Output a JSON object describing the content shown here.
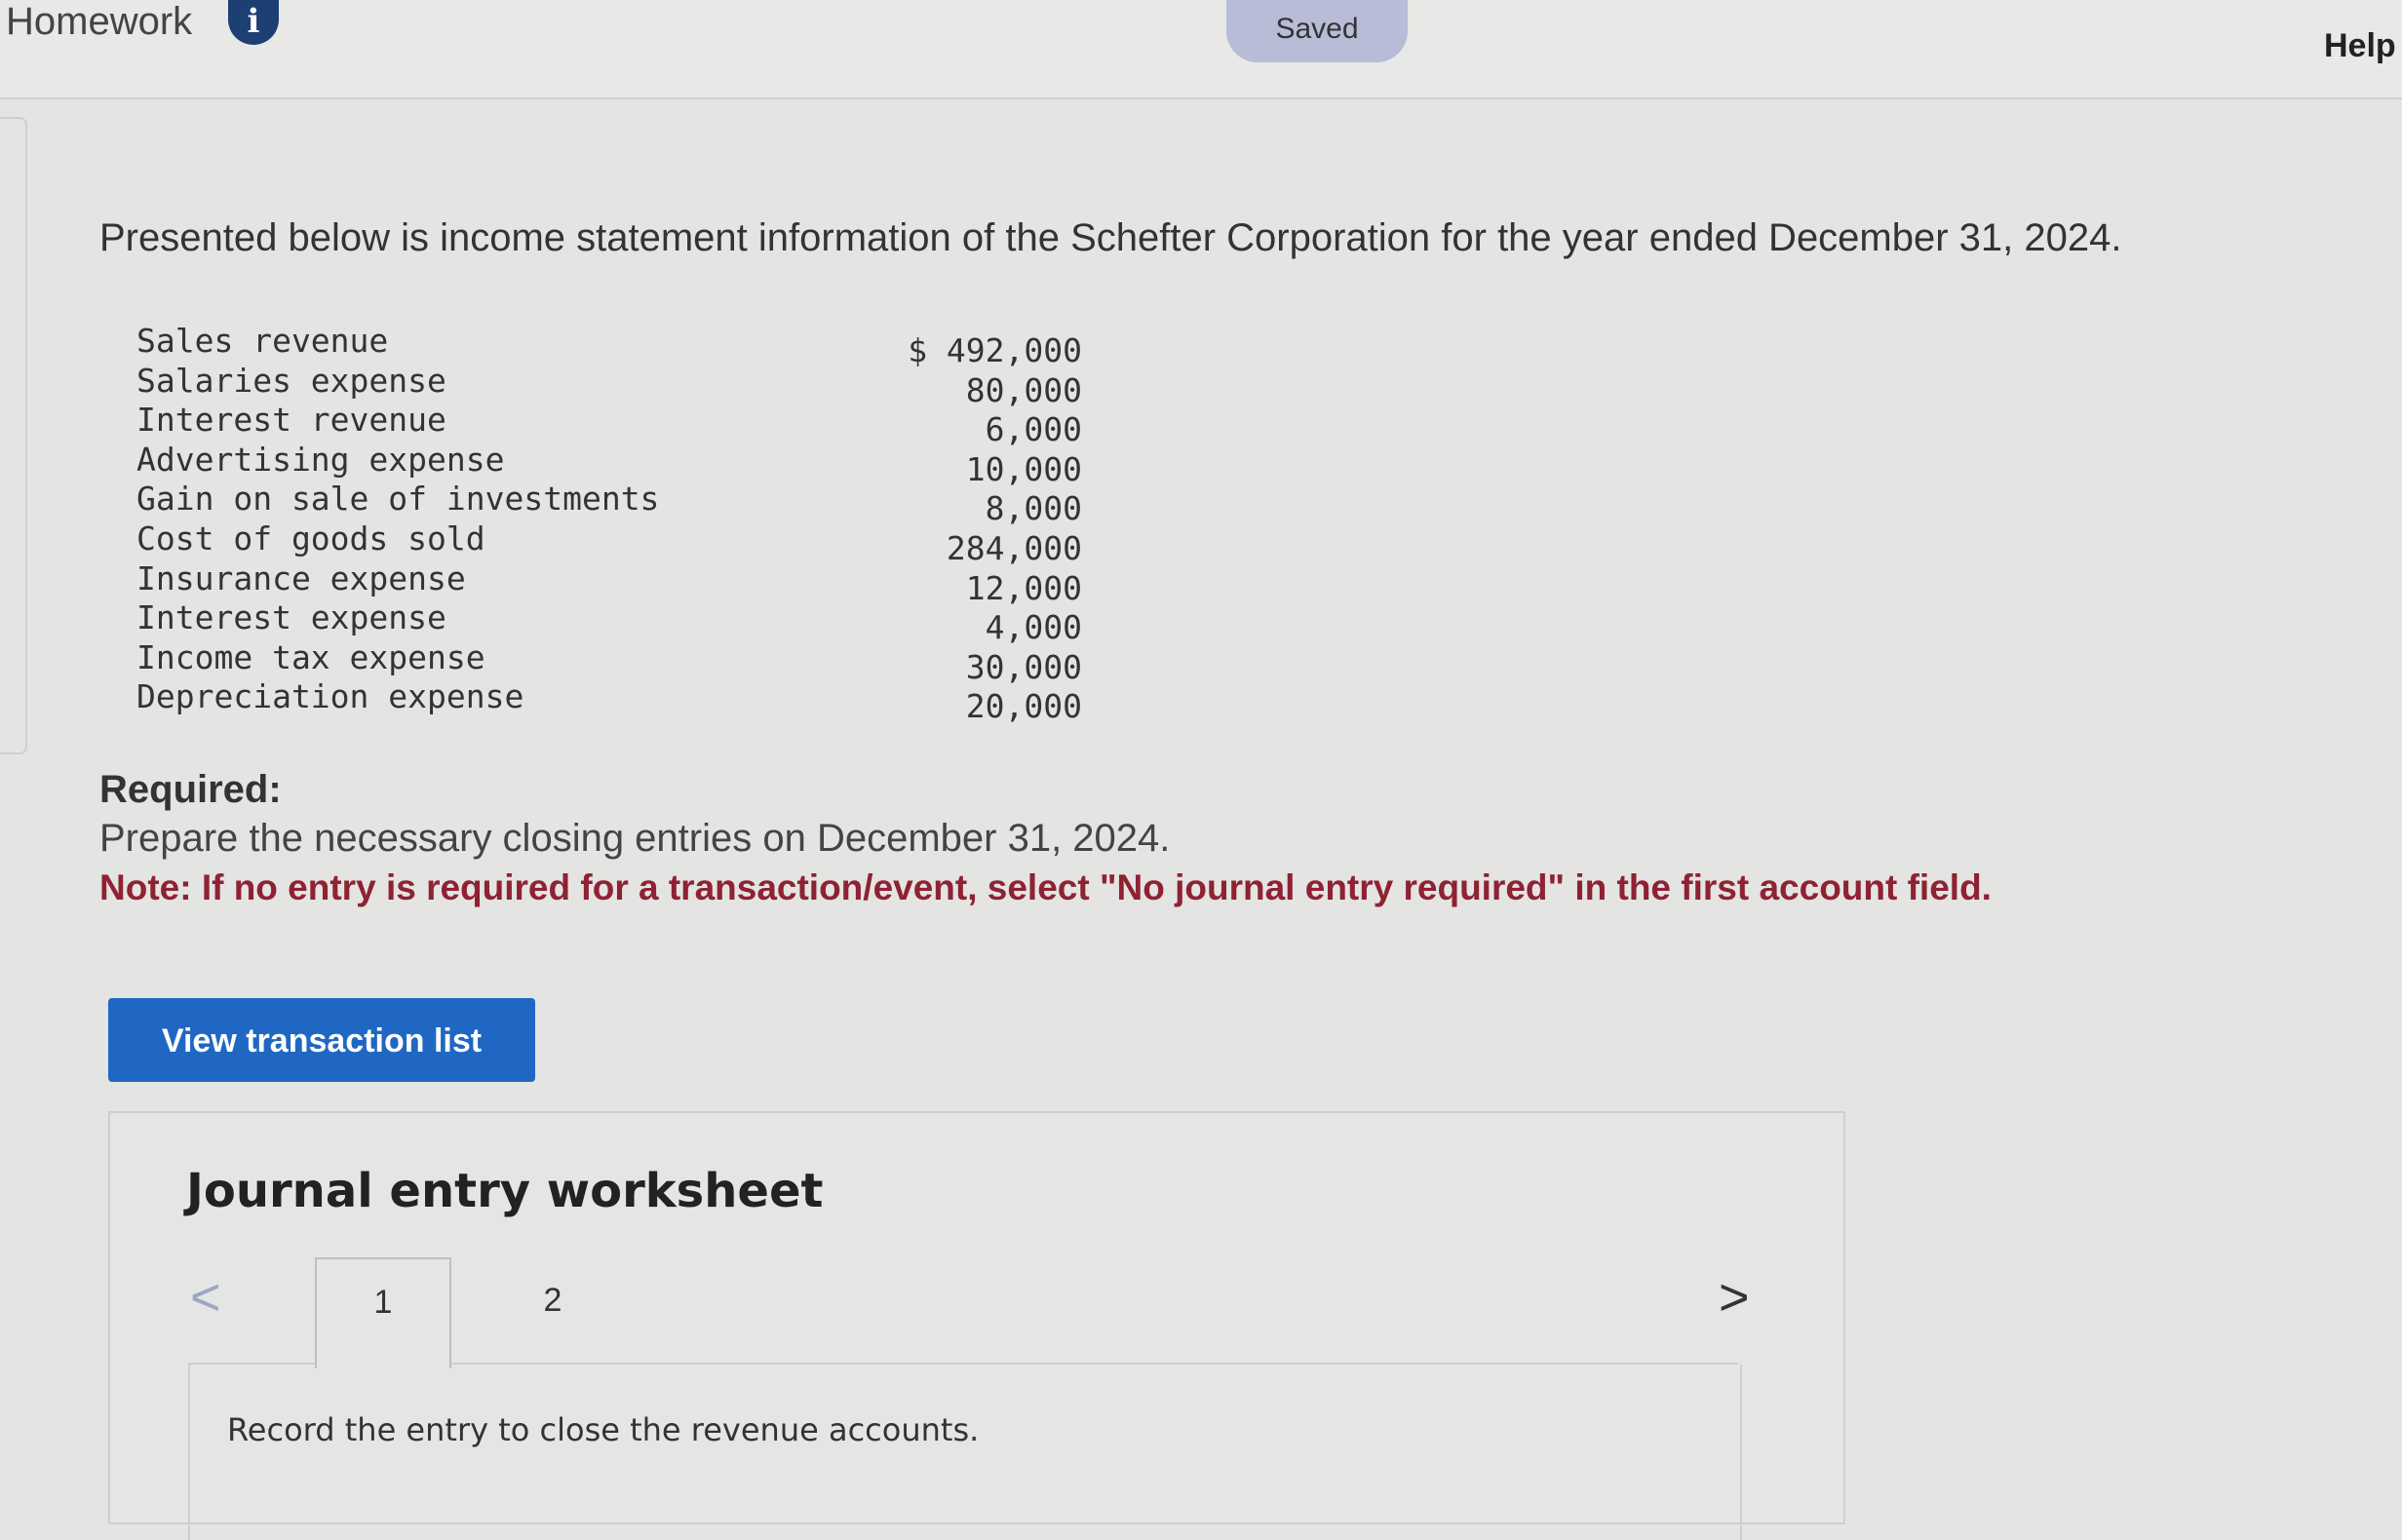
{
  "header": {
    "title": "Homework",
    "info_icon": "i",
    "status": "Saved",
    "help": "Help"
  },
  "intro": "Presented below is income statement information of the Schefter Corporation for the year ended December 31, 2024.",
  "financials": [
    {
      "label": "Sales revenue",
      "value": "$ 492,000"
    },
    {
      "label": "Salaries expense",
      "value": "80,000"
    },
    {
      "label": "Interest revenue",
      "value": "6,000"
    },
    {
      "label": "Advertising expense",
      "value": "10,000"
    },
    {
      "label": "Gain on sale of investments",
      "value": "8,000"
    },
    {
      "label": "Cost of goods sold",
      "value": "284,000"
    },
    {
      "label": "Insurance expense",
      "value": "12,000"
    },
    {
      "label": "Interest expense",
      "value": "4,000"
    },
    {
      "label": "Income tax expense",
      "value": "30,000"
    },
    {
      "label": "Depreciation expense",
      "value": "20,000"
    }
  ],
  "required": {
    "label": "Required:",
    "text": "Prepare the necessary closing entries on December 31, 2024.",
    "note": "Note: If no entry is required for a transaction/event, select \"No journal entry required\" in the first account field."
  },
  "view_button": "View transaction list",
  "worksheet": {
    "title": "Journal entry worksheet",
    "prev_icon": "<",
    "next_icon": ">",
    "tabs": [
      "1",
      "2"
    ],
    "entry_description": "Record the entry to close the revenue accounts."
  },
  "colors": {
    "button_blue": "#1f67c2",
    "note_red": "#8e2233",
    "info_navy": "#1e3f73",
    "saved_pill": "#b8bcd6"
  },
  "icons": {
    "info": "info-icon",
    "prev": "chevron-left-icon",
    "next": "chevron-right-icon"
  }
}
